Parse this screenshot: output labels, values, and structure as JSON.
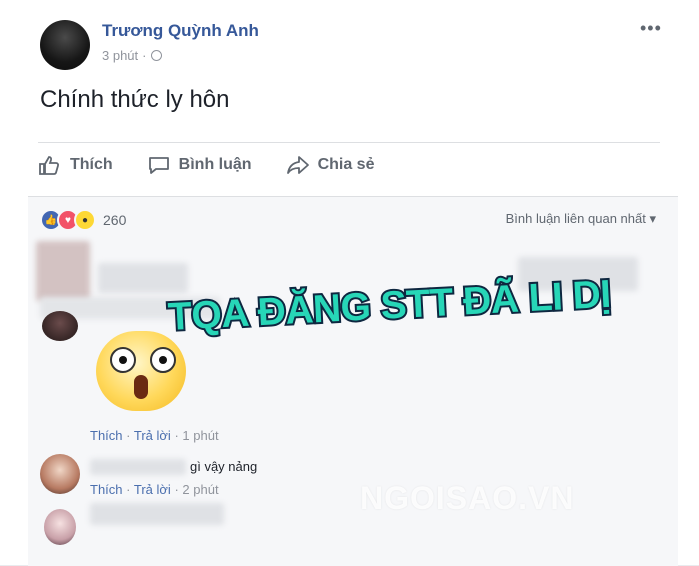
{
  "post": {
    "author": "Trương Quỳnh Anh",
    "time": "3 phút",
    "separator": "·",
    "status": "Chính thức ly hôn",
    "more_icon": "ellipsis-icon"
  },
  "actions": {
    "like_label": "Thích",
    "comment_label": "Bình luận",
    "share_label": "Chia sẻ"
  },
  "reactions": {
    "count": "260",
    "icons": [
      "like-icon",
      "love-icon",
      "wow-icon"
    ]
  },
  "comments": {
    "sort_label": "Bình luận liên quan nhất",
    "sort_caret": "▾",
    "items": [
      {
        "like": "Thích",
        "dot": "·",
        "reply": "Trả lời",
        "time": "1 phút"
      },
      {
        "text": "gì vậy nảng",
        "like": "Thích",
        "dot": "·",
        "reply": "Trả lời",
        "time": "2 phút"
      }
    ]
  },
  "overlay": {
    "text": "TQA ĐĂNG STT ĐÃ LI DỊ"
  },
  "watermark": {
    "text": "NGOISAO.VN"
  },
  "colors": {
    "name_blue": "#365899",
    "overlay_teal": "#27d6b7",
    "overlay_stroke": "#0e2740"
  }
}
